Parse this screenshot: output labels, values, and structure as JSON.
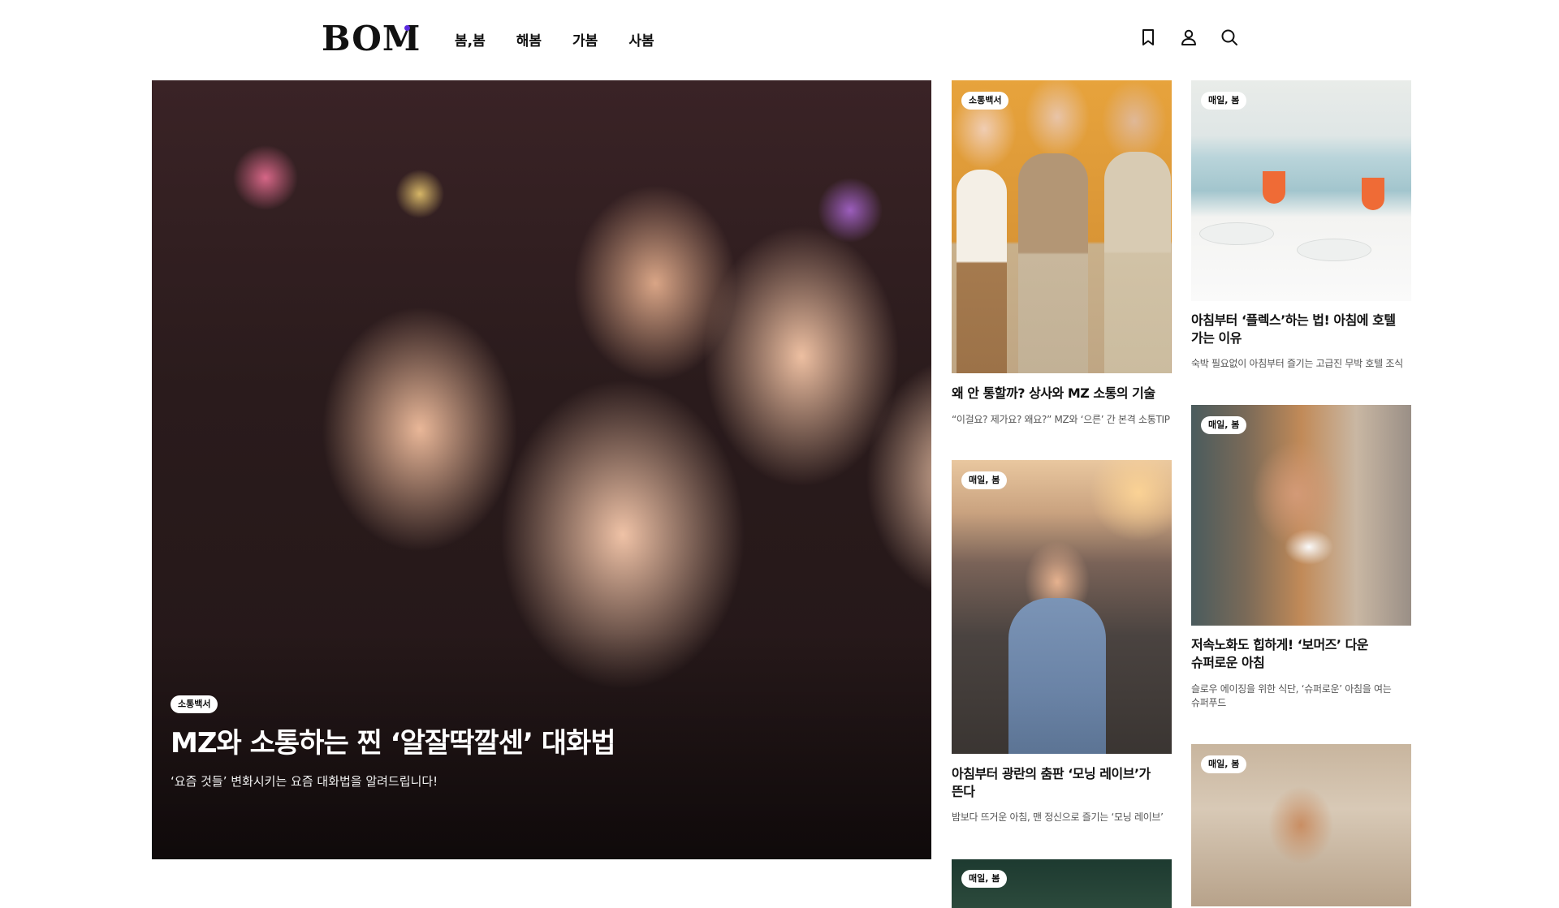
{
  "header": {
    "logo": "BOM",
    "nav": [
      "봄,봄",
      "해봄",
      "가봄",
      "사봄"
    ],
    "icons": [
      "bookmark-icon",
      "user-icon",
      "search-icon"
    ]
  },
  "hero": {
    "tag": "소통백서",
    "title": "MZ와 소통하는 찐 ‘알잘딱깔센’ 대화법",
    "subtitle": "‘요즘 것들’ 변화시키는 요즘 대화법을 알려드립니다!"
  },
  "cards": [
    {
      "tag": "소통백서",
      "title": "왜 안 통할까? 상사와 MZ 소통의 기술",
      "subtitle": "“이걸요? 제가요? 왜요?” MZ와 ‘으른’ 간 본격 소통TIP"
    },
    {
      "tag": "매일, 봄",
      "title_lines": [
        "아침부터 ‘플렉스’하는 법! 아침에 호텔",
        "가는 이유"
      ],
      "subtitle": "숙박 필요없이 아침부터 즐기는 고급진 무박 호텔 조식"
    },
    {
      "tag": "매일, 봄",
      "title_lines": [
        "아침부터 광란의 춤판 ‘모닝 레이브’가",
        "뜬다"
      ],
      "subtitle": "밤보다 뜨거운 아침, 맨 정신으로 즐기는 ‘모닝 레이브’"
    },
    {
      "tag": "매일, 봄",
      "title_lines": [
        "저속노화도 힙하게! ‘보머즈’ 다운",
        "슈퍼로운 아침"
      ],
      "subtitle_lines": [
        "슬로우 에이징을 위한 식단, ‘슈퍼로운’ 아침을 여는",
        "슈퍼푸드"
      ]
    },
    {
      "tag": "매일, 봄"
    },
    {
      "tag": "매일, 봄"
    }
  ]
}
